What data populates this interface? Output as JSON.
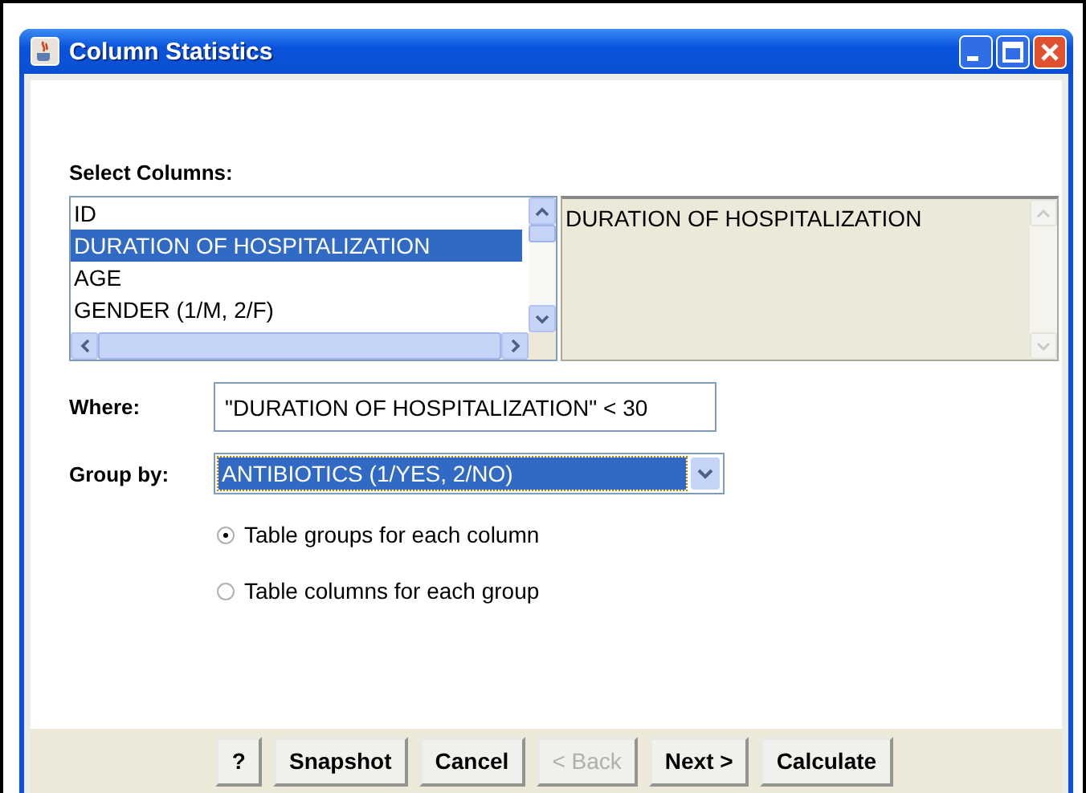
{
  "window": {
    "title": "Column Statistics"
  },
  "select_columns": {
    "label": "Select Columns:",
    "columns": [
      {
        "name": "ID",
        "selected": false
      },
      {
        "name": "DURATION OF HOSPITALIZATION",
        "selected": true
      },
      {
        "name": "AGE",
        "selected": false
      },
      {
        "name": "GENDER (1/M, 2/F)",
        "selected": false
      }
    ],
    "chosen": [
      "DURATION OF HOSPITALIZATION"
    ]
  },
  "where": {
    "label": "Where:",
    "value": "\"DURATION OF HOSPITALIZATION\" < 30"
  },
  "group_by": {
    "label": "Group by:",
    "value": "ANTIBIOTICS (1/YES, 2/NO)"
  },
  "layout_options": [
    {
      "label": "Table groups for each column",
      "selected": true
    },
    {
      "label": "Table columns for each group",
      "selected": false
    }
  ],
  "buttons": [
    {
      "label": "?",
      "disabled": false
    },
    {
      "label": "Snapshot",
      "disabled": false
    },
    {
      "label": "Cancel",
      "disabled": false
    },
    {
      "label": "< Back",
      "disabled": true
    },
    {
      "label": "Next >",
      "disabled": false
    },
    {
      "label": "Calculate",
      "disabled": false
    }
  ]
}
